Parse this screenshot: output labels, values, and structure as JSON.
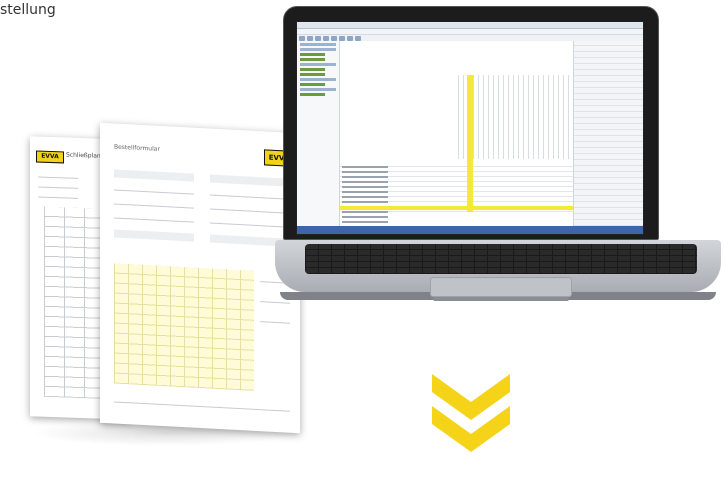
{
  "caption": {
    "text": "stellung"
  },
  "forms": {
    "back_logo": "EVVA",
    "back_title": "Schließplan",
    "front_logo": "EVVA",
    "front_title": "Bestellformular"
  },
  "colors": {
    "accent": "#f4d319",
    "laptop": "#1c1c1c",
    "highlight": "#f4e83a",
    "taskbar": "#3a67a8"
  },
  "icons": {
    "chevron": "double-chevron-down-icon"
  }
}
